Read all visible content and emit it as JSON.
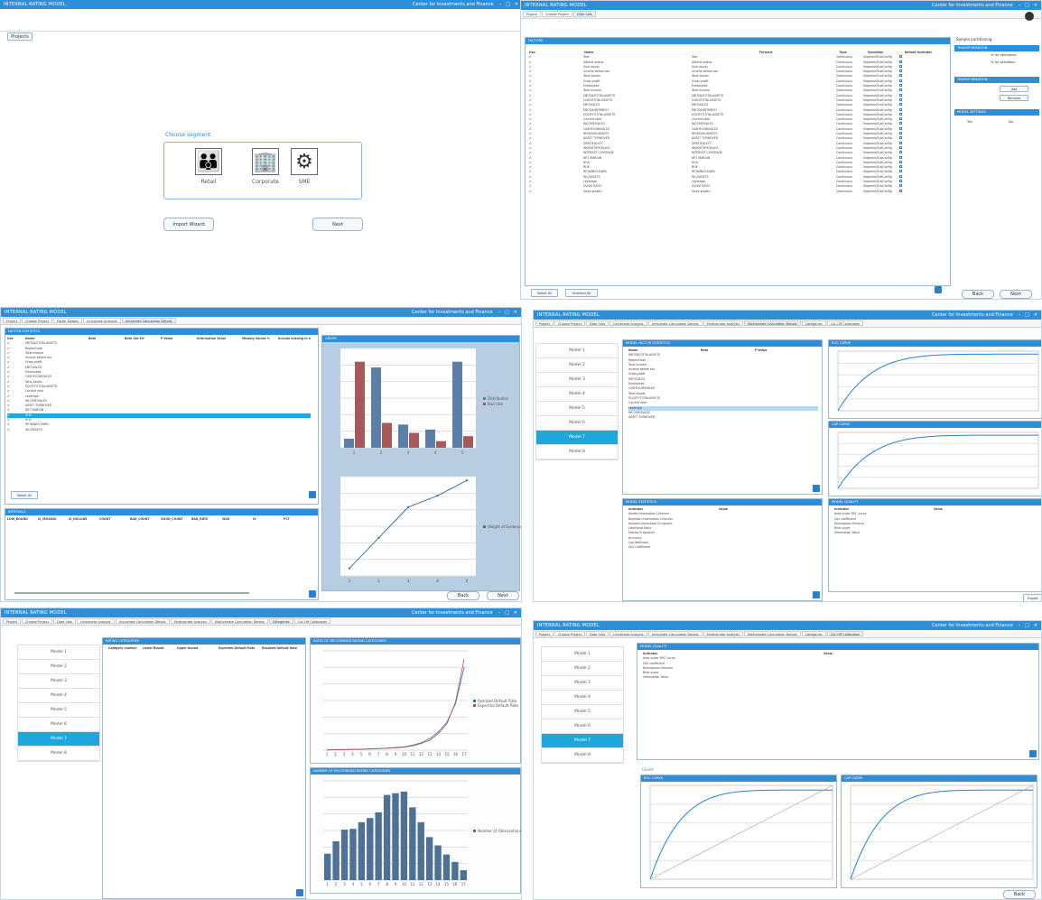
{
  "app": {
    "title": "INTERNAL RATING MODEL",
    "company": "Center for Investments and Finance",
    "brand_color": "#2d8fd8",
    "selected_color": "#1da7dd"
  },
  "start": {
    "projects_button": "Projects",
    "choose_segment": "Choose segment",
    "segments": [
      {
        "label": "Retail",
        "icon": "people-icon"
      },
      {
        "label": "Corporate",
        "icon": "buildings-icon"
      },
      {
        "label": "SME",
        "icon": "gears-icon"
      }
    ],
    "import_wizard": "Import Wizard",
    "next": "Next"
  },
  "tabs_a": [
    "Project",
    "Choose Project",
    "Data Sets"
  ],
  "factors": {
    "title": "FACTORS",
    "headers": [
      "Use",
      "Name",
      "Formula",
      "Type",
      "Operation",
      "Default indicator"
    ],
    "rows": [
      "Year",
      "Default status",
      "Sum equity",
      "Income before tax",
      "Total Assets",
      "Gross profit",
      "Employees",
      "Total Income",
      "EBITDA/TOTALASSETS",
      "CASH/TOTALASSETS",
      "EBIT/SALES",
      "EBITDA/INTEREST",
      "EQUITY/TOTALASSETS",
      "Current ratio",
      "INCOME/SALES",
      "CASHFLOW/SALES",
      "REVENUE/ASSETS",
      "ASSET TURNOVER",
      "DEBT/EQUITY",
      "INVENTORY/SALES",
      "INTEREST COVERAGE",
      "NET MARGIN",
      "ROA",
      "ROE",
      "RETAINED EARN",
      "WC/ASSETS",
      "Leverage",
      "QUICK RATIO",
      "Sales growth"
    ],
    "types": [
      "Continuous",
      "Categorical"
    ],
    "ops": [
      "Segment/SubConfig",
      "Default"
    ],
    "select_all": "Select All",
    "unselect_all": "Unselect All",
    "back": "Back",
    "next": "Next"
  },
  "side_a": {
    "sample_title": "Sample partitioning",
    "pct_calibration": "% for calibration",
    "pct_validation": "% for validation",
    "section_filter": "TRANSFORMATION",
    "add": "Add",
    "remove": "Remove",
    "section_settings": "MODEL SETTINGS",
    "radio1": "Yes",
    "radio2": "No"
  },
  "tabs_c": [
    "Project",
    "Choose Project",
    "Factor Details",
    "Univariate Analysis",
    "Univariate Calculation Details"
  ],
  "univariate": {
    "title": "FACTOR STATISTICS",
    "headers": [
      "Use",
      "Name",
      "Beta",
      "Beta Std Err",
      "P-Value",
      "Information Value",
      "Missing Values %",
      "Include missing in model"
    ],
    "rows": [
      "EBITDA/TOTALASSETS",
      "RegionCode",
      "Total Income",
      "Income before tax",
      "Gross profit",
      "EBIT/SALES",
      "Employees",
      "CASHFLOW/SALES",
      "Total Assets",
      "EQUITY/TOTALASSETS",
      "Current ratio",
      "Leverage",
      "INCOME/SALES",
      "ASSET TURNOVER",
      "NET MARGIN",
      "ROA",
      "ROE",
      "RETAINED EARN",
      "WC/ASSETS"
    ],
    "selected_row": 15,
    "select_all": "Select All",
    "bins_title": "INTERVALS",
    "bins_headers": [
      "LOW_BOUND",
      "IS_MISSING",
      "IS_INCLUDE",
      "COUNT",
      "BAD_COUNT",
      "GOOD_COUNT",
      "BAD_RATE",
      "WOE",
      "IV",
      "PCT"
    ],
    "graph_title": "GRAPH",
    "legend_bar": [
      "Distribution",
      "Bad rate"
    ],
    "legend_line": "Weight of Evidence",
    "back": "Back",
    "next": "Next"
  },
  "tabs_d": [
    "Project",
    "Choose Project",
    "Data Sets",
    "Univariate Analysis",
    "Univariate Calculation Details",
    "Multivariate Analysis",
    "Multivariate Calculation Details",
    "Categories",
    "Cut-Off Calibration"
  ],
  "models": [
    "Model 1",
    "Model 2",
    "Model 3",
    "Model 4",
    "Model 5",
    "Model 6",
    "Model 7",
    "Model 8"
  ],
  "selected_model": 6,
  "multivariate": {
    "title": "MODEL FACTOR STATISTICS",
    "headers": [
      "Name",
      "Beta",
      "P-Value"
    ],
    "roc_title": "ROC CURVE",
    "cap_title": "CAP CURVE",
    "stats_title": "MODEL STATISTICS",
    "quality_title": "MODEL QUALITY",
    "stats_headers": [
      "Indicator",
      "Value"
    ],
    "stats": [
      "Akaike Information Criterion",
      "Bayesian Information Criterion",
      "Hosmer-Lemeshow Chi-square",
      "Likelihood Ratio",
      "Pseudo R-squared",
      "Accuracy",
      "Log likelihood",
      "Gini Coefficient"
    ],
    "quality": [
      "Area under ROC curve",
      "Gini coefficient",
      "Kolmogorov-Smirnov",
      "Brier score",
      "Information Value"
    ],
    "export": "Export"
  },
  "categories": {
    "title": "RATING CATEGORIES",
    "headers": [
      "Category number",
      "Lower Bound",
      "Upper bound",
      "Expected Default Rate",
      "Realized Default Rate"
    ],
    "chart1_title": "RATES OF RECOGNISED RATING CATEGORIES",
    "chart2_title": "NUMBER OF RECOGNISED RATING CATEGORIES",
    "legend1": [
      "Realized Default Rate",
      "Expected Default Rate"
    ],
    "legend2": "Number of Observations",
    "bars": [
      320,
      470,
      610,
      620,
      700,
      750,
      820,
      1030,
      1050,
      1070,
      880,
      700,
      520,
      420,
      310,
      220,
      120
    ]
  },
  "cutoff": {
    "title": "MODEL QUALITY",
    "headers": [
      "Indicator",
      "Value"
    ],
    "rows": [
      "Area under ROC curve",
      "Gini coefficient",
      "Kolmogorov-Smirnov",
      "Brier score",
      "Information Value"
    ],
    "section": "Charts",
    "roc": "ROC CURVE",
    "cap": "CAP CURVE",
    "back": "Back"
  },
  "chart_data": [
    {
      "type": "bar",
      "title": "",
      "categories": [
        "1",
        "2",
        "3",
        "4",
        "5"
      ],
      "series": [
        {
          "name": "Distribution",
          "values": [
            550,
            4850,
            1400,
            1100,
            5200
          ]
        },
        {
          "name": "Bad rate",
          "values": [
            5200,
            1500,
            900,
            400,
            700
          ]
        }
      ]
    },
    {
      "type": "line",
      "title": "",
      "x": [
        "1",
        "2",
        "3",
        "4",
        "5"
      ],
      "series": [
        {
          "name": "Weight of Evidence",
          "values": [
            -1.0,
            -0.2,
            0.6,
            0.9,
            1.3
          ]
        }
      ]
    },
    {
      "type": "line",
      "title": "RATES OF RECOGNISED RATING CATEGORIES",
      "x": [
        1,
        2,
        3,
        4,
        5,
        6,
        7,
        8,
        9,
        10,
        11,
        12,
        13,
        14,
        15,
        16,
        17
      ],
      "series": [
        {
          "name": "Realized Default Rate",
          "values": [
            0.002,
            0.003,
            0.004,
            0.005,
            0.006,
            0.008,
            0.01,
            0.012,
            0.016,
            0.02,
            0.03,
            0.045,
            0.07,
            0.11,
            0.17,
            0.28,
            0.5
          ]
        },
        {
          "name": "Expected Default Rate",
          "values": [
            0.001,
            0.002,
            0.003,
            0.004,
            0.005,
            0.007,
            0.009,
            0.011,
            0.014,
            0.018,
            0.026,
            0.04,
            0.06,
            0.1,
            0.16,
            0.29,
            0.55
          ]
        }
      ]
    },
    {
      "type": "bar",
      "title": "NUMBER OF RECOGNISED RATING CATEGORIES",
      "categories": [
        "1",
        "2",
        "3",
        "4",
        "5",
        "6",
        "7",
        "8",
        "9",
        "10",
        "11",
        "12",
        "13",
        "14",
        "15",
        "16",
        "17"
      ],
      "series": [
        {
          "name": "Number of Observations",
          "values": [
            320,
            470,
            610,
            620,
            700,
            750,
            820,
            1030,
            1050,
            1070,
            880,
            700,
            520,
            420,
            310,
            220,
            120
          ]
        }
      ]
    }
  ]
}
